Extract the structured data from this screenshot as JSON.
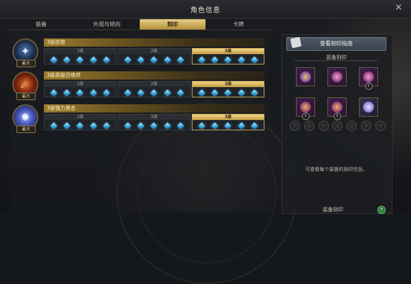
{
  "window": {
    "title": "角色信息",
    "close_glyph": "✕"
  },
  "tabs": [
    {
      "label": "装备",
      "active": false
    },
    {
      "label": "外观与倾向",
      "active": false
    },
    {
      "label": "刻印",
      "active": true
    },
    {
      "label": "卡牌",
      "active": false
    }
  ],
  "engravings": [
    {
      "name": "3级怨恨",
      "badge": "最大",
      "icon": "grudge-icon",
      "levels": [
        {
          "label": "1级",
          "gems": 5
        },
        {
          "label": "2级",
          "gems": 5
        },
        {
          "label": "3级",
          "gems": 5
        }
      ],
      "active_level": 3
    },
    {
      "name": "3级高级召唤师",
      "badge": "最大",
      "icon": "master-summoner-icon",
      "levels": [
        {
          "label": "1级",
          "gems": 5
        },
        {
          "label": "2级",
          "gems": 5
        },
        {
          "label": "3级",
          "gems": 5
        }
      ],
      "active_level": 3
    },
    {
      "name": "3级强力袭击",
      "badge": "最大",
      "icon": "keen-blunt-icon",
      "levels": [
        {
          "label": "1级",
          "gems": 5
        },
        {
          "label": "2级",
          "gems": 5
        },
        {
          "label": "3级",
          "gems": 5
        }
      ],
      "active_level": 3
    }
  ],
  "right": {
    "guide_button": "查看刻印指南",
    "section_title": "装备刻印",
    "equipment_slots": [
      {
        "icon": "necklace-icon",
        "number": ""
      },
      {
        "icon": "earring-icon",
        "number": ""
      },
      {
        "icon": "earring-icon",
        "number": "2"
      },
      {
        "icon": "ring-icon",
        "number": "1"
      },
      {
        "icon": "ring-icon",
        "number": "2"
      },
      {
        "icon": "bracelet-icon",
        "number": ""
      }
    ],
    "accessory_count": 7,
    "info_text": "可查看每个装备的刻印信息。",
    "bottom_title": "装备刻印",
    "help_glyph": "?"
  },
  "colors": {
    "accent_gold": "#c9a653",
    "gem_blue": "#41b4ec",
    "active_tab": "#e7cf86"
  }
}
